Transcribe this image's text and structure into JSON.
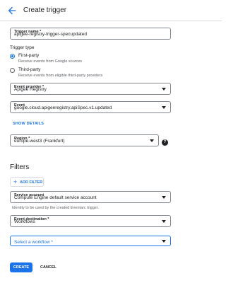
{
  "header": {
    "title": "Create trigger"
  },
  "trigger_name": {
    "label": "Trigger name *",
    "value": "apigee-registry-trigger-specupdated"
  },
  "trigger_type": {
    "label": "Trigger type",
    "options": [
      {
        "label": "First-party",
        "description": "Receive events from Google sources",
        "selected": true
      },
      {
        "label": "Third-party",
        "description": "Receive events from eligible third-party providers",
        "selected": false
      }
    ]
  },
  "event_provider": {
    "label": "Event provider *",
    "value": "Apigee Registry"
  },
  "event": {
    "label": "Event",
    "value": "google.cloud.apigeeregistry.apiSpec.v1.updated"
  },
  "show_details": {
    "label": "SHOW DETAILS"
  },
  "region": {
    "label": "Region *",
    "value": "europe-west3 (Frankfurt)",
    "help_icon": "?"
  },
  "filters": {
    "heading": "Filters",
    "add_filter_label": "ADD FILTER"
  },
  "service_account": {
    "label": "Service account",
    "value": "Compute Engine default service account",
    "hint": "Identity to be used by the created Eventarc trigger."
  },
  "event_destination": {
    "label": "Event destination *",
    "value": "Workflows"
  },
  "workflow": {
    "placeholder": "Select a workflow *"
  },
  "actions": {
    "create_label": "CREATE",
    "cancel_label": "CANCEL"
  },
  "colors": {
    "accent": "#1a73e8",
    "text": "#202124",
    "secondary_text": "#5f6368"
  }
}
